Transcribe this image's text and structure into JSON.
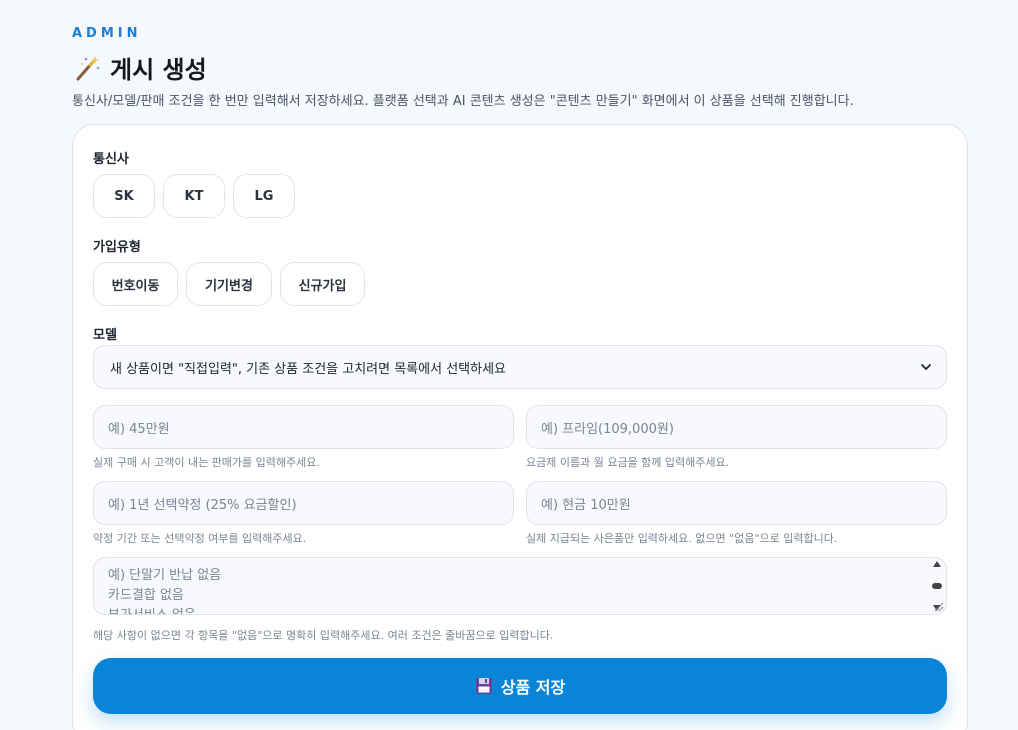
{
  "header": {
    "eyebrow": "ADMIN",
    "title": "게시 생성",
    "subtitle": "통신사/모델/판매 조건을 한 번만 입력해서 저장하세요. 플랫폼 선택과 AI 콘텐츠 생성은 \"콘텐츠 만들기\" 화면에서 이 상품을 선택해 진행합니다.",
    "title_icon": "magic-wand-icon"
  },
  "form": {
    "carrier": {
      "label": "통신사",
      "options": [
        "SK",
        "KT",
        "LG"
      ]
    },
    "join_type": {
      "label": "가입유형",
      "options": [
        "번호이동",
        "기기변경",
        "신규가입"
      ]
    },
    "model": {
      "label": "모델",
      "selected": "새 상품이면 \"직접입력\", 기존 상품 조건을 고치려면 목록에서 선택하세요"
    },
    "price": {
      "placeholder": "예) 45만원",
      "hint": "실제 구매 시 고객이 내는 판매가를 입력해주세요."
    },
    "plan": {
      "placeholder": "예) 프라임(109,000원)",
      "hint": "요금제 이름과 월 요금을 함께 입력해주세요."
    },
    "contract": {
      "placeholder": "예) 1년 선택약정 (25% 요금할인)",
      "hint": "약정 기간 또는 선택약정 여부를 입력해주세요."
    },
    "gift": {
      "placeholder": "예) 현금 10만원",
      "hint": "실제 지급되는 사은품만 입력하세요. 없으면 \"없음\"으로 입력합니다."
    },
    "conditions": {
      "placeholder_lines": [
        "예) 단말기 반납 없음",
        "카드결합 없음",
        "부가서비스 없음"
      ],
      "hint": "해당 사항이 없으면 각 항목을 \"없음\"으로 명확히 입력해주세요. 여러 조건은 줄바꿈으로 입력합니다."
    },
    "save_button": {
      "label": "상품 저장",
      "icon": "floppy-disk-icon"
    }
  },
  "colors": {
    "accent": "#0a84d6",
    "background": "#f5f8fc"
  }
}
